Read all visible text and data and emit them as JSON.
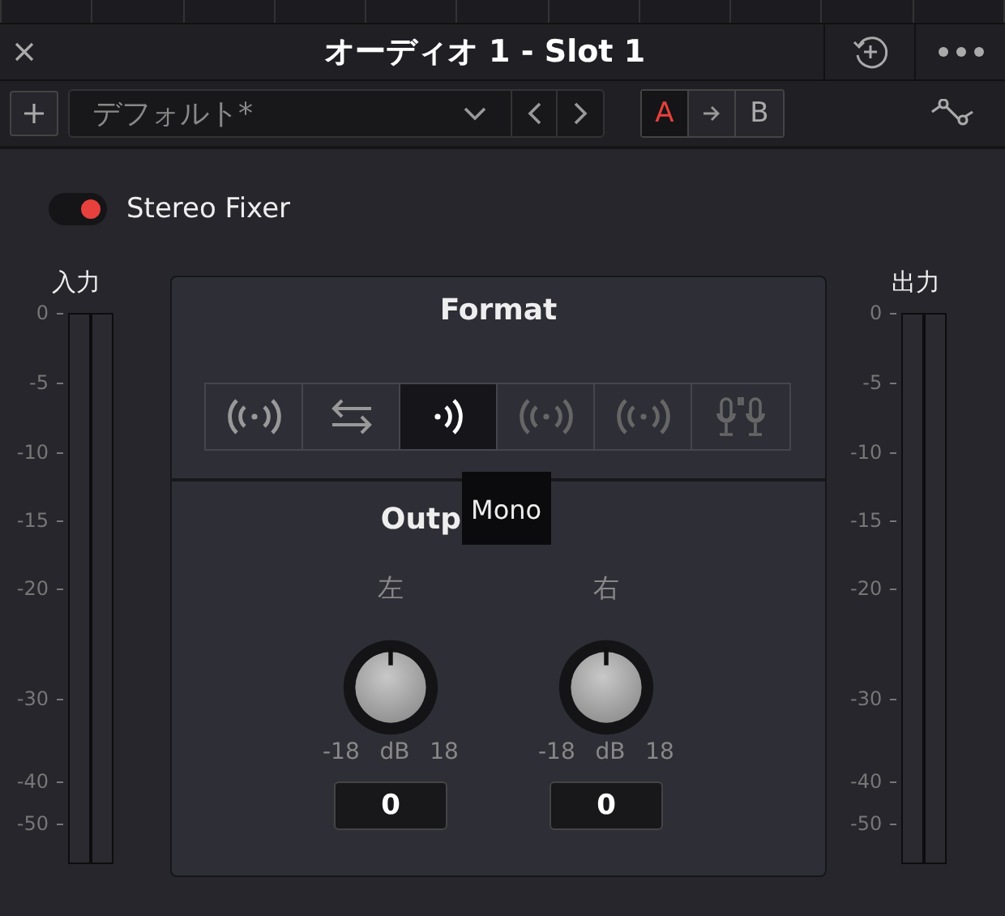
{
  "window": {
    "title": "オーディオ 1 - Slot 1"
  },
  "toolbar": {
    "preset": "デフォルト*",
    "ab": [
      {
        "label": "A",
        "selected": true
      },
      {
        "label": "B",
        "selected": false
      }
    ]
  },
  "plugin": {
    "name": "Stereo Fixer",
    "on": true
  },
  "input_meter": {
    "label": "入力",
    "ticks": [
      "0",
      "-5",
      "-10",
      "-15",
      "-20",
      "-30",
      "-40",
      "-50"
    ]
  },
  "output_meter": {
    "label": "出力",
    "ticks": [
      "0",
      "-5",
      "-10",
      "-15",
      "-20",
      "-30",
      "-40",
      "-50"
    ]
  },
  "format": {
    "title": "Format",
    "options": [
      {
        "kind": "waves",
        "selected": false,
        "dim": false
      },
      {
        "kind": "swap",
        "selected": false,
        "dim": false
      },
      {
        "kind": "mono",
        "selected": true,
        "dim": false
      },
      {
        "kind": "waves",
        "selected": false,
        "dim": true
      },
      {
        "kind": "waves",
        "selected": false,
        "dim": true
      },
      {
        "kind": "mics",
        "selected": false,
        "dim": true
      }
    ],
    "tooltip": "Mono"
  },
  "output_gain": {
    "title": "Outp",
    "channels": [
      {
        "label": "左",
        "level": 0.5,
        "min": "-18",
        "unit": "dB",
        "max": "18",
        "value": "0"
      },
      {
        "label": "右",
        "level": 0.5,
        "min": "-18",
        "unit": "dB",
        "max": "18",
        "value": "0"
      }
    ]
  }
}
